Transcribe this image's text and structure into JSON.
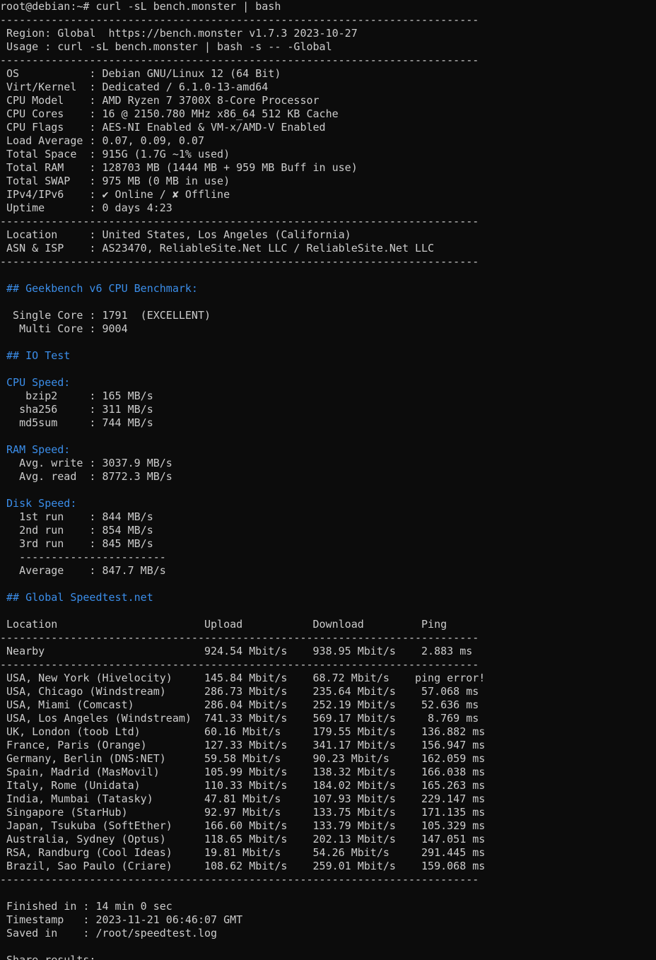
{
  "colors": {
    "background": "#0c0c0c",
    "text": "#cccccc",
    "accent_blue": "#3b8eea"
  },
  "terminal": {
    "lines": [
      {
        "text": "root@debian:~# curl -sL bench.monster | bash",
        "style": "normal"
      },
      {
        "text": "---------------------------------------------------------------------------",
        "style": "sep"
      },
      {
        "text": " Region: Global  https://bench.monster v1.7.3 2023-10-27",
        "style": "normal"
      },
      {
        "text": " Usage : curl -sL bench.monster | bash -s -- -Global",
        "style": "normal"
      },
      {
        "text": "---------------------------------------------------------------------------",
        "style": "sep"
      },
      {
        "text": " OS           : Debian GNU/Linux 12 (64 Bit)",
        "style": "normal"
      },
      {
        "text": " Virt/Kernel  : Dedicated / 6.1.0-13-amd64",
        "style": "normal"
      },
      {
        "text": " CPU Model    : AMD Ryzen 7 3700X 8-Core Processor",
        "style": "normal"
      },
      {
        "text": " CPU Cores    : 16 @ 2150.780 MHz x86_64 512 KB Cache",
        "style": "normal"
      },
      {
        "text": " CPU Flags    : AES-NI Enabled & VM-x/AMD-V Enabled",
        "style": "normal"
      },
      {
        "text": " Load Average : 0.07, 0.09, 0.07",
        "style": "normal"
      },
      {
        "text": " Total Space  : 915G (1.7G ~1% used)",
        "style": "normal"
      },
      {
        "text": " Total RAM    : 128703 MB (1444 MB + 959 MB Buff in use)",
        "style": "normal"
      },
      {
        "text": " Total SWAP   : 975 MB (0 MB in use)",
        "style": "normal"
      },
      {
        "text": " IPv4/IPv6    : ✔ Online / ✘ Offline",
        "style": "normal"
      },
      {
        "text": " Uptime       : 0 days 4:23",
        "style": "normal"
      },
      {
        "text": "---------------------------------------------------------------------------",
        "style": "sep"
      },
      {
        "text": " Location     : United States, Los Angeles (California)",
        "style": "normal"
      },
      {
        "text": " ASN & ISP    : AS23470, ReliableSite.Net LLC / ReliableSite.Net LLC",
        "style": "normal"
      },
      {
        "text": "---------------------------------------------------------------------------",
        "style": "sep"
      },
      {
        "text": "",
        "style": "normal"
      },
      {
        "text": " ## Geekbench v6 CPU Benchmark:",
        "style": "blue"
      },
      {
        "text": "",
        "style": "normal"
      },
      {
        "text": "  Single Core : 1791  (EXCELLENT)",
        "style": "normal"
      },
      {
        "text": "   Multi Core : 9004",
        "style": "normal"
      },
      {
        "text": "",
        "style": "normal"
      },
      {
        "text": " ## IO Test",
        "style": "blue"
      },
      {
        "text": "",
        "style": "normal"
      },
      {
        "text": " CPU Speed:",
        "style": "blue"
      },
      {
        "text": "    bzip2     : 165 MB/s",
        "style": "normal"
      },
      {
        "text": "   sha256     : 311 MB/s",
        "style": "normal"
      },
      {
        "text": "   md5sum     : 744 MB/s",
        "style": "normal"
      },
      {
        "text": "",
        "style": "normal"
      },
      {
        "text": " RAM Speed:",
        "style": "blue"
      },
      {
        "text": "   Avg. write : 3037.9 MB/s",
        "style": "normal"
      },
      {
        "text": "   Avg. read  : 8772.3 MB/s",
        "style": "normal"
      },
      {
        "text": "",
        "style": "normal"
      },
      {
        "text": " Disk Speed:",
        "style": "blue"
      },
      {
        "text": "   1st run    : 844 MB/s",
        "style": "normal"
      },
      {
        "text": "   2nd run    : 854 MB/s",
        "style": "normal"
      },
      {
        "text": "   3rd run    : 845 MB/s",
        "style": "normal"
      },
      {
        "text": "   -----------------------",
        "style": "sep"
      },
      {
        "text": "   Average    : 847.7 MB/s",
        "style": "normal"
      },
      {
        "text": "",
        "style": "normal"
      },
      {
        "text": " ## Global Speedtest.net",
        "style": "blue"
      },
      {
        "text": "",
        "style": "normal"
      },
      {
        "text": " Location                       Upload           Download         Ping",
        "style": "normal"
      },
      {
        "text": "---------------------------------------------------------------------------",
        "style": "sep"
      },
      {
        "text": " Nearby                         924.54 Mbit/s    938.95 Mbit/s    2.883 ms",
        "style": "normal"
      },
      {
        "text": "---------------------------------------------------------------------------",
        "style": "sep"
      },
      {
        "text": " USA, New York (Hivelocity)     145.84 Mbit/s    68.72 Mbit/s    ping error!",
        "style": "normal"
      },
      {
        "text": " USA, Chicago (Windstream)      286.73 Mbit/s    235.64 Mbit/s    57.068 ms",
        "style": "normal"
      },
      {
        "text": " USA, Miami (Comcast)           286.04 Mbit/s    252.19 Mbit/s    52.636 ms",
        "style": "normal"
      },
      {
        "text": " USA, Los Angeles (Windstream)  741.33 Mbit/s    569.17 Mbit/s     8.769 ms",
        "style": "normal"
      },
      {
        "text": " UK, London (toob Ltd)          60.16 Mbit/s     179.55 Mbit/s    136.882 ms",
        "style": "normal"
      },
      {
        "text": " France, Paris (Orange)         127.33 Mbit/s    341.17 Mbit/s    156.947 ms",
        "style": "normal"
      },
      {
        "text": " Germany, Berlin (DNS:NET)      59.58 Mbit/s     90.23 Mbit/s     162.059 ms",
        "style": "normal"
      },
      {
        "text": " Spain, Madrid (MasMovil)       105.99 Mbit/s    138.32 Mbit/s    166.038 ms",
        "style": "normal"
      },
      {
        "text": " Italy, Rome (Unidata)          110.33 Mbit/s    184.02 Mbit/s    165.263 ms",
        "style": "normal"
      },
      {
        "text": " India, Mumbai (Tatasky)        47.81 Mbit/s     107.93 Mbit/s    229.147 ms",
        "style": "normal"
      },
      {
        "text": " Singapore (StarHub)            92.97 Mbit/s     133.75 Mbit/s    171.135 ms",
        "style": "normal"
      },
      {
        "text": " Japan, Tsukuba (SoftEther)     166.60 Mbit/s    133.79 Mbit/s    105.329 ms",
        "style": "normal"
      },
      {
        "text": " Australia, Sydney (Optus)      118.65 Mbit/s    202.13 Mbit/s    147.051 ms",
        "style": "normal"
      },
      {
        "text": " RSA, Randburg (Cool Ideas)     19.81 Mbit/s     54.26 Mbit/s     291.445 ms",
        "style": "normal"
      },
      {
        "text": " Brazil, Sao Paulo (Criare)     108.62 Mbit/s    259.01 Mbit/s    159.068 ms",
        "style": "normal"
      },
      {
        "text": "---------------------------------------------------------------------------",
        "style": "sep"
      },
      {
        "text": "",
        "style": "normal"
      },
      {
        "text": " Finished in : 14 min 0 sec",
        "style": "normal"
      },
      {
        "text": " Timestamp   : 2023-11-21 06:46:07 GMT",
        "style": "normal"
      },
      {
        "text": " Saved in    : /root/speedtest.log",
        "style": "normal"
      },
      {
        "text": "",
        "style": "normal"
      },
      {
        "text": " Share results:",
        "style": "normal"
      }
    ]
  }
}
